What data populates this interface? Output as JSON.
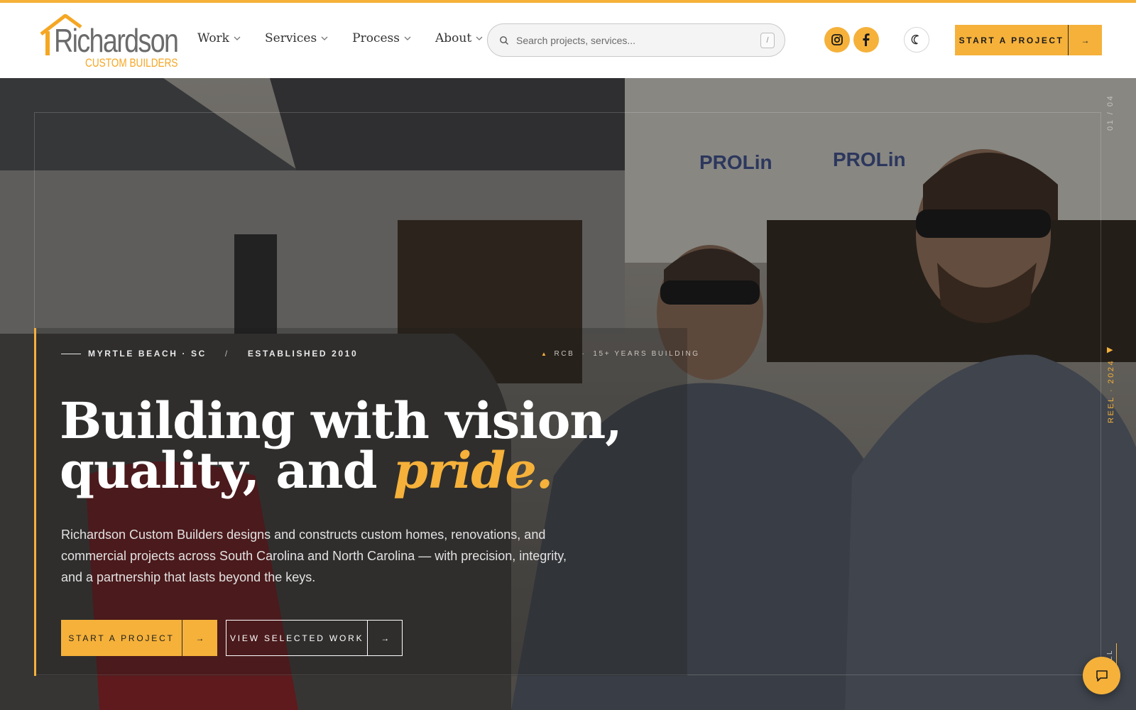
{
  "brand": {
    "name": "Richardson",
    "tagline": "CUSTOM BUILDERS",
    "accent_color": "#f5b13a"
  },
  "nav": {
    "items": [
      {
        "label": "Work"
      },
      {
        "label": "Services"
      },
      {
        "label": "Process"
      },
      {
        "label": "About"
      }
    ]
  },
  "search": {
    "placeholder": "Search projects, services...",
    "shortcut": "/",
    "icon": "search-icon"
  },
  "social": {
    "instagram_icon": "instagram-icon",
    "facebook_icon": "facebook-icon"
  },
  "theme_toggle": {
    "icon": "moon-icon"
  },
  "header_cta": {
    "label": "START A PROJECT",
    "arrow": "→"
  },
  "hero": {
    "location": "MYRTLE BEACH · SC",
    "separator": "/",
    "established": "ESTABLISHED 2010",
    "tag_brand": "RCB",
    "tag_dot": "·",
    "tag_years": "15+ YEARS BUILDING",
    "headline_line1": "Building with vision,",
    "headline_line2_plain": "quality, and ",
    "headline_accent": "pride.",
    "lede": "Richardson Custom Builders designs and constructs custom homes, renovations, and commercial projects across South Carolina and North Carolina — with precision, integrity, and a partnership that lasts beyond the keys.",
    "primary_cta": "START A PROJECT",
    "secondary_cta": "VIEW SELECTED WORK",
    "arrow": "→",
    "slide_counter": "01 / 04",
    "reel_label": "REEL · 2024",
    "scroll_label": "LL"
  },
  "chat": {
    "icon": "chat-icon"
  }
}
